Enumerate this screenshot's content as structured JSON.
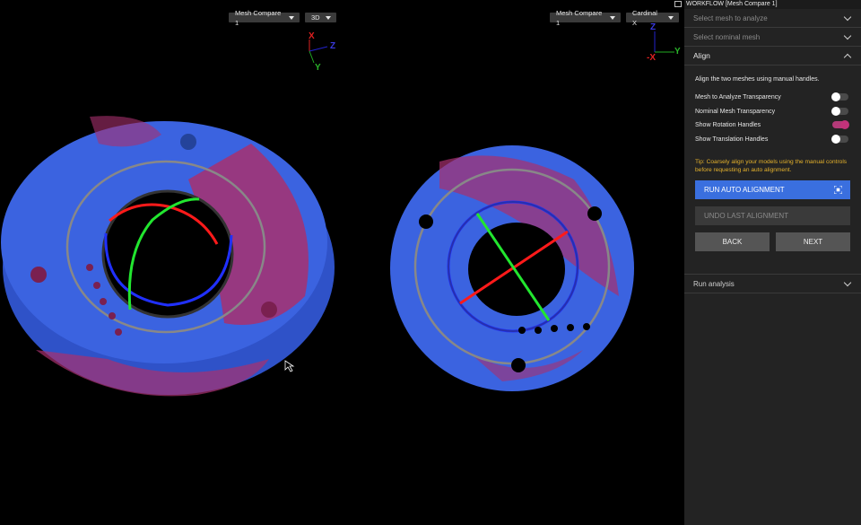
{
  "viewport": {
    "left_view": {
      "dropdown_mesh": "Mesh Compare 1",
      "dropdown_mode": "3D"
    },
    "right_view": {
      "dropdown_mesh": "Mesh Compare 1",
      "dropdown_view": "Cardinal X"
    },
    "left_axes": {
      "x": "X",
      "y": "Y",
      "z": "Z"
    },
    "right_axes": {
      "neg_x": "-X",
      "y": "Y",
      "z": "Z"
    },
    "colors": {
      "mesh_blue": "#3b63e0",
      "deviation_magenta": "#a8306e",
      "handle_red": "#ff1a1a",
      "handle_green": "#22e62f",
      "handle_blue": "#1a2cff"
    }
  },
  "panel": {
    "title": "WORKFLOW [Mesh Compare 1]",
    "select_mesh": "Select mesh to analyze",
    "select_nominal": "Select nominal mesh",
    "align": {
      "header": "Align",
      "description": "Align the two meshes using manual handles.",
      "toggles": [
        {
          "label": "Mesh to Analyze Transparency",
          "on": false
        },
        {
          "label": "Nominal Mesh Transparency",
          "on": false
        },
        {
          "label": "Show Rotation Handles",
          "on": true
        },
        {
          "label": "Show Translation Handles",
          "on": false
        }
      ],
      "tip": "Tip: Coarsely align your models using the manual controls before requesting an auto alignment.",
      "run_auto": "RUN AUTO ALIGNMENT",
      "undo": "UNDO LAST ALIGNMENT",
      "back": "BACK",
      "next": "NEXT"
    },
    "run_analysis": "Run analysis",
    "accent_color": "#3a6fdf",
    "tip_color": "#e5b22c"
  }
}
